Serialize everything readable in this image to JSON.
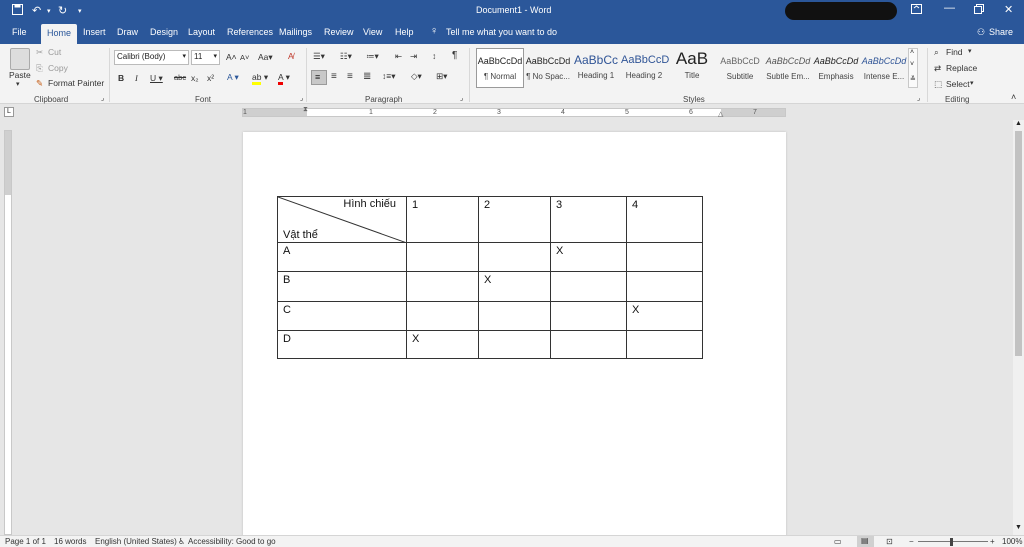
{
  "titlebar": {
    "doc_title": "Document1 - Word",
    "tell_me": "Tell me what you want to do",
    "share": "Share"
  },
  "tabs": [
    "File",
    "Home",
    "Insert",
    "Draw",
    "Design",
    "Layout",
    "References",
    "Mailings",
    "Review",
    "View",
    "Help"
  ],
  "clipboard": {
    "paste": "Paste",
    "cut": "Cut",
    "copy": "Copy",
    "format_painter": "Format Painter",
    "label": "Clipboard"
  },
  "font": {
    "family": "Calibri (Body)",
    "size": "11",
    "label": "Font"
  },
  "paragraph": {
    "label": "Paragraph"
  },
  "styles": {
    "label": "Styles",
    "items": [
      {
        "preview": "AaBbCcDd",
        "name": "¶ Normal"
      },
      {
        "preview": "AaBbCcDd",
        "name": "¶ No Spac..."
      },
      {
        "preview": "AaBbCc",
        "name": "Heading 1"
      },
      {
        "preview": "AaBbCcD",
        "name": "Heading 2"
      },
      {
        "preview": "AaB",
        "name": "Title"
      },
      {
        "preview": "AaBbCcD",
        "name": "Subtitle"
      },
      {
        "preview": "AaBbCcDd",
        "name": "Subtle Em..."
      },
      {
        "preview": "AaBbCcDd",
        "name": "Emphasis"
      },
      {
        "preview": "AaBbCcDd",
        "name": "Intense E..."
      }
    ]
  },
  "editing": {
    "find": "Find",
    "replace": "Replace",
    "select": "Select",
    "label": "Editing"
  },
  "ruler_numbers": [
    "1",
    "1",
    "2",
    "3",
    "4",
    "5",
    "6",
    "7"
  ],
  "table": {
    "header_top": "Hình chiếu",
    "header_bottom": "Vật thể",
    "columns": [
      "1",
      "2",
      "3",
      "4"
    ],
    "rows": [
      {
        "label": "A",
        "cells": [
          "",
          "",
          "X",
          ""
        ]
      },
      {
        "label": "B",
        "cells": [
          "",
          "X",
          "",
          ""
        ]
      },
      {
        "label": "C",
        "cells": [
          "",
          "",
          "",
          "X"
        ]
      },
      {
        "label": "D",
        "cells": [
          "X",
          "",
          "",
          ""
        ]
      }
    ]
  },
  "status": {
    "page": "Page 1 of 1",
    "words": "16 words",
    "language": "English (United States)",
    "accessibility": "Accessibility: Good to go",
    "zoom": "100%"
  },
  "colors": {
    "accent": "#2b579a"
  }
}
